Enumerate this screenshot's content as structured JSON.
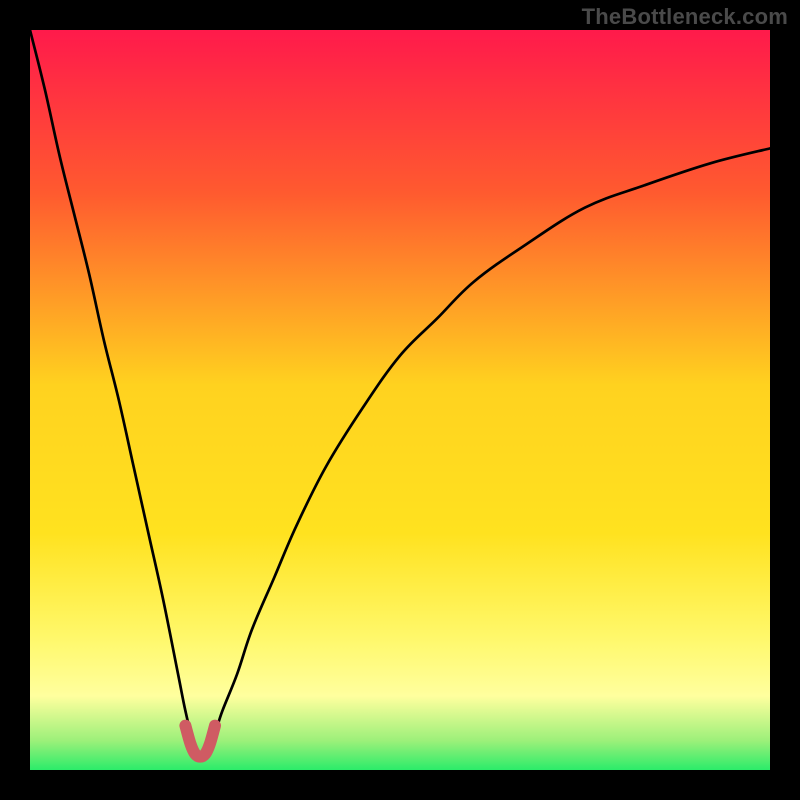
{
  "watermark": "TheBottleneck.com",
  "colors": {
    "outer": "#000000",
    "grad_top": "#ff1a4b",
    "grad_mid_upper": "#ff6a2a",
    "grad_mid": "#ffd21f",
    "grad_lower": "#fff86a",
    "grad_band": "#ffff9e",
    "grad_bottom": "#2bec6a",
    "curve": "#000000",
    "accent": "#cf5b63"
  },
  "chart_data": {
    "type": "line",
    "title": "",
    "xlabel": "",
    "ylabel": "",
    "xlim": [
      0,
      100
    ],
    "ylim": [
      0,
      100
    ],
    "grid": false,
    "notes": "Bottleneck-style V curve: y is percentage bottleneck, minimum near x≈23. Background is red→green vertical gradient (red high bottleneck at top, green low at bottom). Pink accent dots mark the smooth trough.",
    "series": [
      {
        "name": "bottleneck-curve",
        "x": [
          0,
          2,
          4,
          6,
          8,
          10,
          12,
          14,
          16,
          18,
          20,
          21,
          22,
          23,
          24,
          25,
          26,
          28,
          30,
          33,
          36,
          40,
          45,
          50,
          55,
          60,
          67,
          75,
          83,
          92,
          100
        ],
        "values": [
          100,
          92,
          83,
          75,
          67,
          58,
          50,
          41,
          32,
          23,
          13,
          8,
          4,
          2,
          3,
          5,
          8,
          13,
          19,
          26,
          33,
          41,
          49,
          56,
          61,
          66,
          71,
          76,
          79,
          82,
          84
        ]
      },
      {
        "name": "trough-accent",
        "x": [
          21,
          21.7,
          22.3,
          23,
          23.7,
          24.3,
          25
        ],
        "values": [
          6,
          3.5,
          2.2,
          1.8,
          2.2,
          3.5,
          6
        ]
      }
    ]
  }
}
